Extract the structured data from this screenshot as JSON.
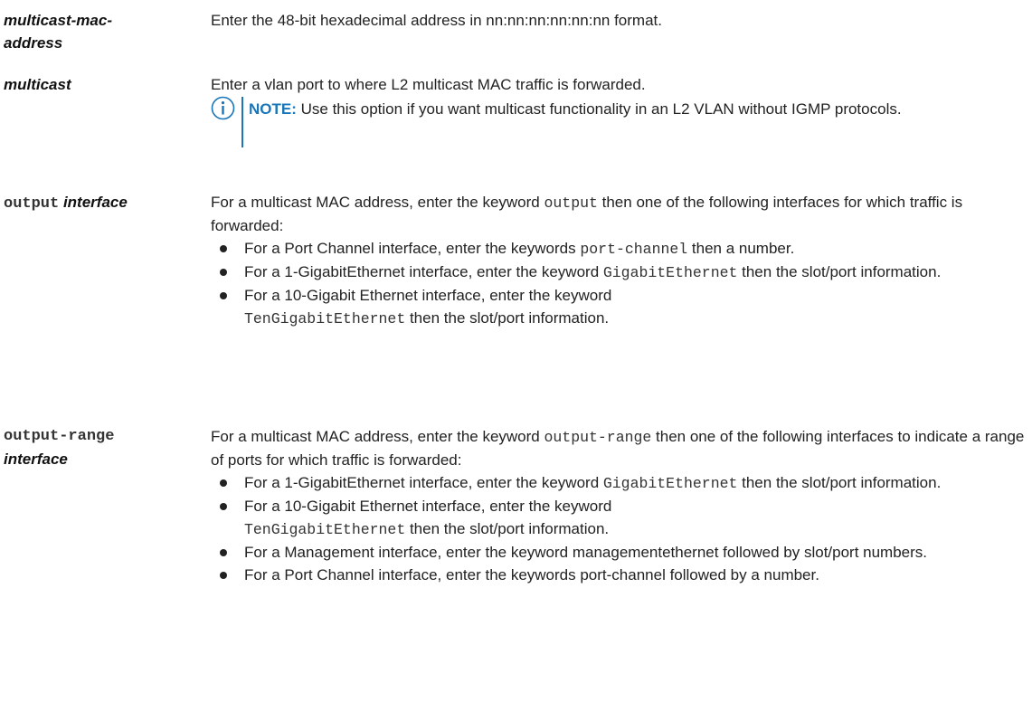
{
  "params": {
    "mac": {
      "term": "multicast-mac-\naddress",
      "desc": "Enter the 48-bit hexadecimal address in nn:nn:nn:nn:nn:nn format."
    },
    "multicast": {
      "term": "multicast",
      "desc": "Enter a vlan port to where L2 multicast MAC traffic is forwarded.",
      "note_label": "NOTE:",
      "note_text": " Use this option if you want multicast functionality in an L2 VLAN without IGMP protocols.",
      "note_icon": "info-icon"
    },
    "output": {
      "term_keyword": "output",
      "term_italic": "interface",
      "intro_pre": "For a multicast MAC address, enter the keyword ",
      "intro_code": "output",
      "intro_post": " then one of the following interfaces for which traffic is forwarded:",
      "items": [
        {
          "pre": "For a Port Channel interface, enter the keywords ",
          "code": "port-channel",
          "post": " then a number."
        },
        {
          "pre": "For a 1-GigabitEthernet interface, enter the keyword ",
          "code": "GigabitEthernet",
          "post": " then the slot/port information."
        },
        {
          "pre": "For a 10-Gigabit Ethernet interface, enter the keyword ",
          "code": "TenGigabitEthernet",
          "post": " then the slot/port information."
        }
      ]
    },
    "output_range": {
      "term_keyword": "output-range",
      "term_italic": "interface",
      "intro_pre": "For a multicast MAC address, enter the keyword ",
      "intro_code": "output-range",
      "intro_post": " then one of the following interfaces to indicate a range of ports for which traffic is forwarded:",
      "items": [
        {
          "pre": "For a 1-GigabitEthernet interface, enter the keyword ",
          "code": "GigabitEthernet",
          "post": " then the slot/port information."
        },
        {
          "pre": "For a 10-Gigabit Ethernet interface, enter the keyword ",
          "code": "TenGigabitEthernet",
          "post": " then the slot/port information."
        },
        {
          "pre": "For a Management interface, enter the keyword managementethernet followed by slot/port numbers.",
          "code": "",
          "post": ""
        },
        {
          "pre": "For a Port Channel interface, enter the keywords port-channel followed by a number.",
          "code": "",
          "post": ""
        }
      ]
    }
  },
  "colors": {
    "accent": "#1976b8",
    "text": "#222222"
  }
}
